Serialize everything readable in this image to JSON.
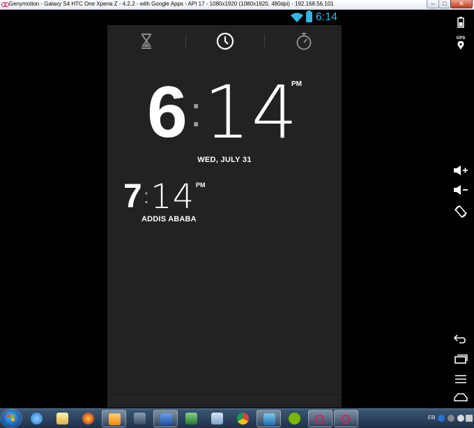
{
  "window": {
    "title": "Genymotion - Galaxy S4  HTC One  Xperia Z - 4.2.2 - with Google Apps - API 17 - 1080x1920 (1080x1920, 480dpi) - 192.168.56.101",
    "minimize_glyph": "–",
    "maximize_glyph": "□",
    "close_glyph": "✕"
  },
  "status_bar": {
    "time": "6:14",
    "accent": "#33b5e5",
    "icons": [
      "wifi-icon",
      "battery-icon"
    ]
  },
  "tabs": [
    {
      "name": "timer",
      "icon": "hourglass-icon",
      "selected": false
    },
    {
      "name": "clock",
      "icon": "clock-icon",
      "selected": true
    },
    {
      "name": "stopwatch",
      "icon": "stopwatch-icon",
      "selected": false
    }
  ],
  "clock": {
    "hour": "6",
    "separator": ":",
    "minutes": "14",
    "ampm": "PM",
    "date": "WED, JULY 31"
  },
  "world_clock": {
    "hour": "7",
    "separator": ":",
    "minutes": "14",
    "ampm": "PM",
    "city": "ADDIS ABABA"
  },
  "sidebar": {
    "gps_label": "GPS",
    "buttons": [
      "battery-icon",
      "gps-icon",
      "volume-up-icon",
      "volume-down-icon",
      "rotate-icon",
      "back-icon",
      "recent-apps-icon",
      "menu-icon",
      "home-icon"
    ]
  },
  "taskbar": {
    "tray_language": "FR",
    "apps": [
      "start-button",
      "ie-icon",
      "explorer-icon",
      "firefox-icon",
      "outlook-icon",
      "app-icon",
      "word-icon",
      "excel-icon",
      "app-icon",
      "chrome-icon",
      "lync-icon",
      "spotify-icon",
      "genymotion-icon",
      "genymotion-icon"
    ]
  }
}
